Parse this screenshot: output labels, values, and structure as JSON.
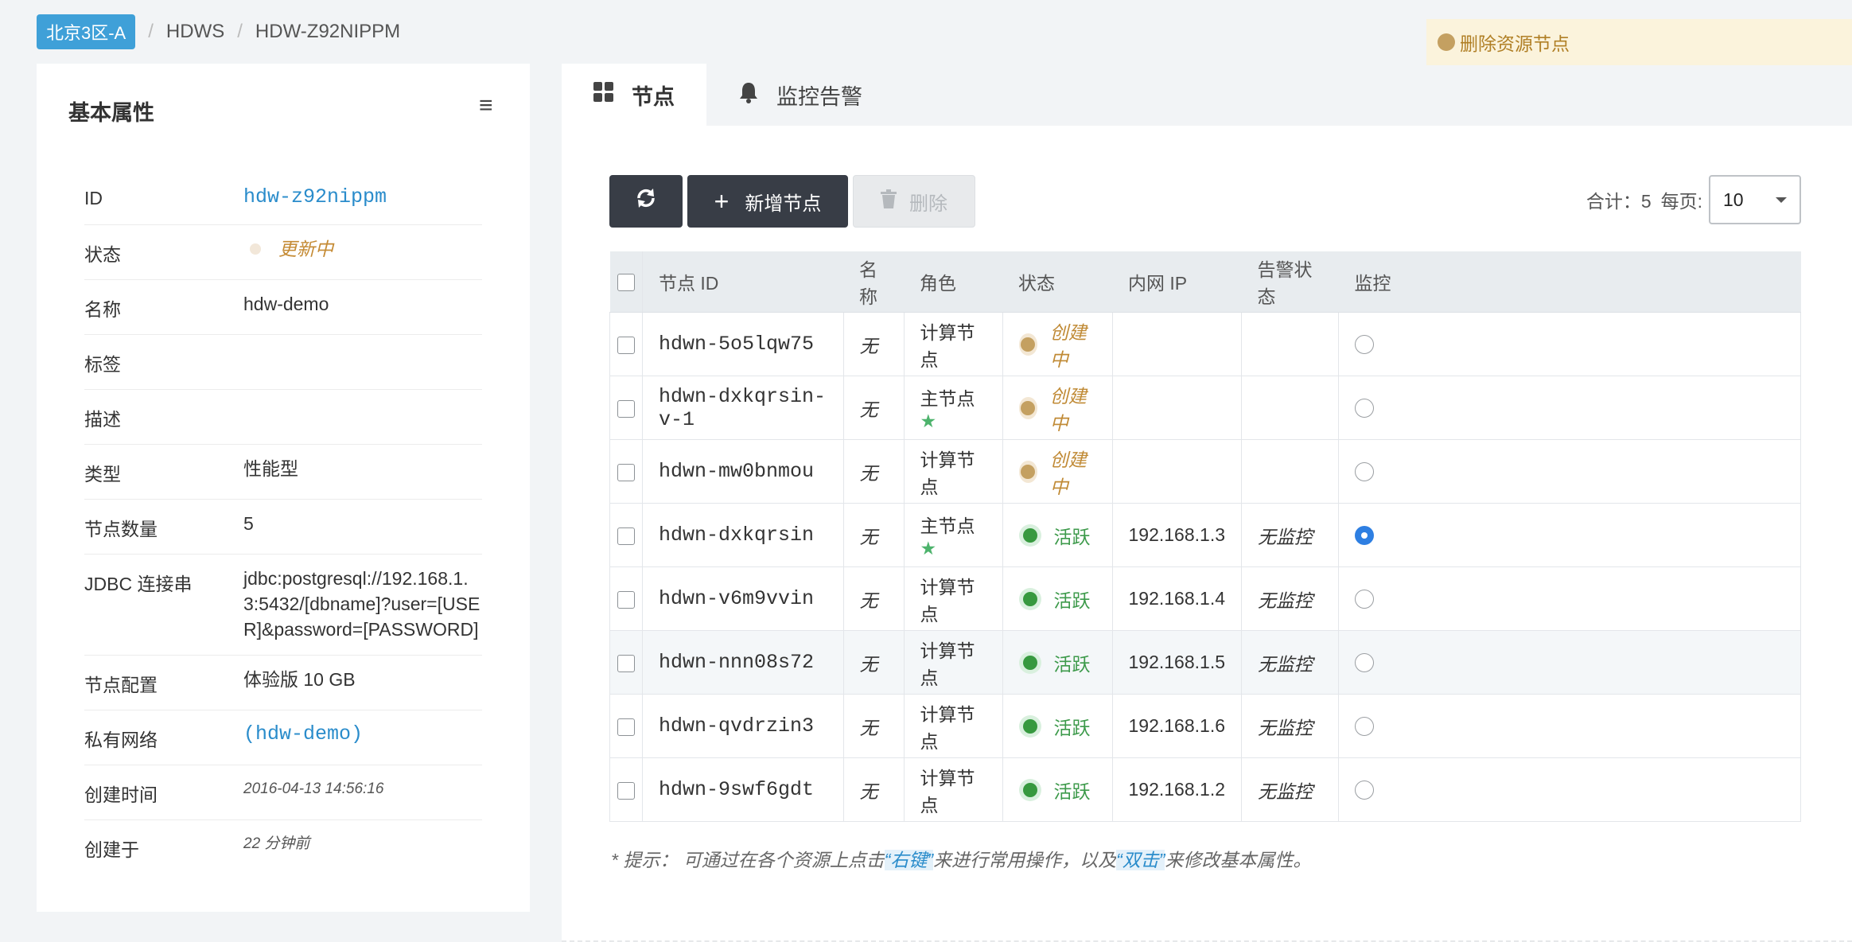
{
  "breadcrumb": {
    "zone": "北京3区-A",
    "items": [
      "HDWS",
      "HDW-Z92NIPPM"
    ]
  },
  "notice": {
    "text": "删除资源节点",
    "dot_color": "#c4a061"
  },
  "left_panel": {
    "title": "基本属性",
    "menu_icon": "hamburger-icon",
    "properties": [
      {
        "key": "ID",
        "value": "hdw-z92nippm"
      },
      {
        "key": "状态",
        "value": "更新中"
      },
      {
        "key": "名称",
        "value": "hdw-demo"
      },
      {
        "key": "标签",
        "value": ""
      },
      {
        "key": "描述",
        "value": ""
      },
      {
        "key": "类型",
        "value": "性能型"
      },
      {
        "key": "节点数量",
        "value": "5"
      },
      {
        "key": "JDBC 连接串",
        "value": "jdbc:postgresql://192.168.1.3:5432/[dbname]?user=[USER]&password=[PASSWORD]"
      },
      {
        "key": "节点配置",
        "value": "体验版 10 GB"
      },
      {
        "key": "私有网络",
        "value": "(hdw-demo)"
      },
      {
        "key": "创建时间",
        "value": "2016-04-13 14:56:16"
      },
      {
        "key": "创建于",
        "value": "22 分钟前"
      }
    ]
  },
  "tabs": [
    {
      "label": "节点",
      "icon": "grid-icon",
      "active": true
    },
    {
      "label": "监控告警",
      "icon": "bell-icon",
      "active": false
    }
  ],
  "toolbar": {
    "refresh_icon": "refresh-icon",
    "add_label": "新增节点",
    "delete_label": "删除"
  },
  "pager": {
    "total_label": "合计：5",
    "per_page_label": "每页:",
    "per_page_value": "10"
  },
  "table": {
    "headers": [
      "节点 ID",
      "名称",
      "角色",
      "状态",
      "内网 IP",
      "告警状态",
      "监控"
    ],
    "rows": [
      {
        "id": "hdwn-5o5lqw75",
        "name": "无",
        "role": "计算节点",
        "star": "",
        "status": "创建中",
        "ip": "",
        "alarm": "",
        "monitor": false
      },
      {
        "id": "hdwn-dxkqrsin-v-1",
        "name": "无",
        "role": "主节点",
        "star": "★",
        "status": "创建中",
        "ip": "",
        "alarm": "",
        "monitor": false
      },
      {
        "id": "hdwn-mw0bnmou",
        "name": "无",
        "role": "计算节点",
        "star": "",
        "status": "创建中",
        "ip": "",
        "alarm": "",
        "monitor": false
      },
      {
        "id": "hdwn-dxkqrsin",
        "name": "无",
        "role": "主节点",
        "star": "★",
        "status": "活跃",
        "ip": "192.168.1.3",
        "alarm": "无监控",
        "monitor": true
      },
      {
        "id": "hdwn-v6m9vvin",
        "name": "无",
        "role": "计算节点",
        "star": "",
        "status": "活跃",
        "ip": "192.168.1.4",
        "alarm": "无监控",
        "monitor": false
      },
      {
        "id": "hdwn-nnn08s72",
        "name": "无",
        "role": "计算节点",
        "star": "",
        "status": "活跃",
        "ip": "192.168.1.5",
        "alarm": "无监控",
        "monitor": false
      },
      {
        "id": "hdwn-qvdrzin3",
        "name": "无",
        "role": "计算节点",
        "star": "",
        "status": "活跃",
        "ip": "192.168.1.6",
        "alarm": "无监控",
        "monitor": false
      },
      {
        "id": "hdwn-9swf6gdt",
        "name": "无",
        "role": "计算节点",
        "star": "",
        "status": "活跃",
        "ip": "192.168.1.2",
        "alarm": "无监控",
        "monitor": false
      }
    ]
  },
  "tip": {
    "prefix": "* 提示：  可通过在各个资源上点击",
    "hl1": "“右键”",
    "middle": "来进行常用操作，以及",
    "hl2": "“双击”",
    "suffix": "来修改基本属性。"
  },
  "colors": {
    "accent": "#2a8ccb",
    "zone_badge": "#3fa0d8",
    "creating": "#c4a061",
    "active": "#37993f",
    "star": "#4db36c"
  }
}
